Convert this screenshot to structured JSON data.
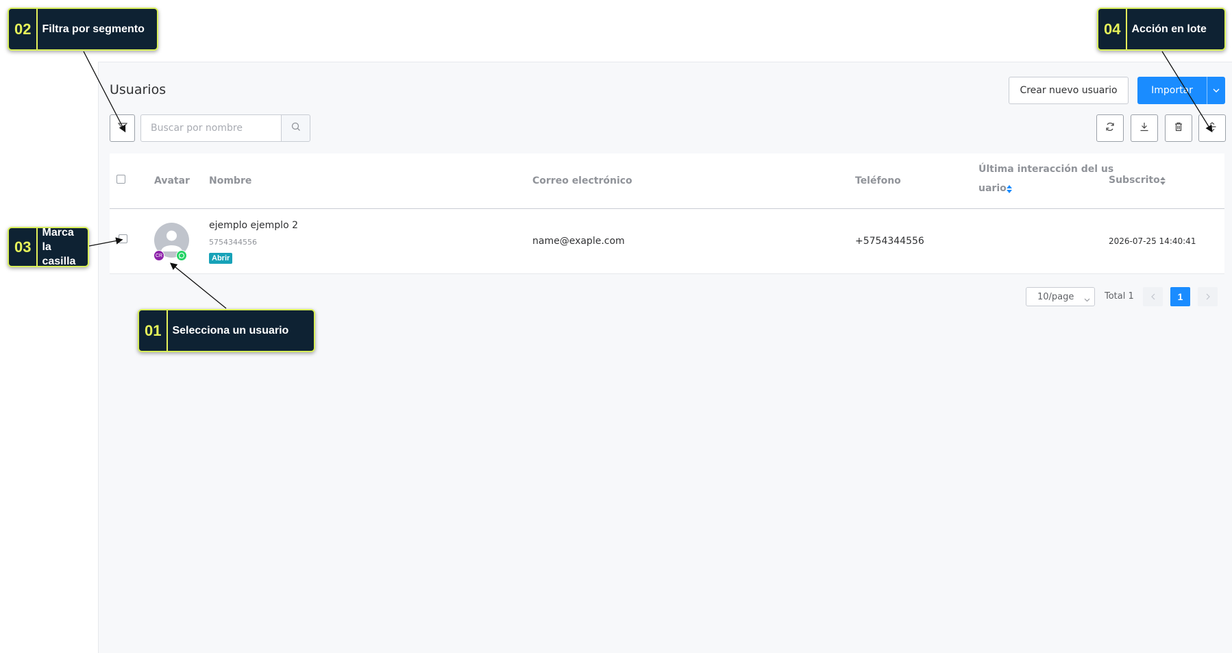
{
  "page": {
    "title": "Usuarios"
  },
  "toolbar": {
    "create_label": "Crear nuevo usuario",
    "import_label": "Importar",
    "search_placeholder": "Buscar por nombre"
  },
  "table": {
    "headers": {
      "avatar": "Avatar",
      "name": "Nombre",
      "email": "Correo electrónico",
      "phone": "Teléfono",
      "last_interaction_1": "Última interacción del us",
      "last_interaction_2": "uario",
      "subscribed": "Subscrito"
    },
    "rows": [
      {
        "name": "ejemplo ejemplo 2",
        "id": "5754344556",
        "status": "Abrir",
        "avatar_badge": "CR",
        "email": "name@exaple.com",
        "phone": "+5754344556",
        "last_interaction": "",
        "subscribed": "2026-07-25 14:40:41"
      }
    ]
  },
  "pagination": {
    "page_size": "10/page",
    "total": "Total 1",
    "current": "1"
  },
  "callouts": {
    "c01": {
      "num": "01",
      "text": "Selecciona un usuario"
    },
    "c02": {
      "num": "02",
      "text": "Filtra por segmento"
    },
    "c03": {
      "num": "03",
      "text_1": "Marca",
      "text_2": "la",
      "text_3": "casilla"
    },
    "c04": {
      "num": "04",
      "text": "Acción en lote"
    }
  },
  "colors": {
    "primary": "#1a8cff",
    "callout_bg": "#0e2233",
    "callout_accent": "#e6f35a",
    "status_tag": "#17a2b8"
  },
  "icons": [
    "filter-icon",
    "search-icon",
    "refresh-icon",
    "download-icon",
    "delete-icon",
    "batch-action-icon",
    "chevron-down-icon",
    "chevron-left-icon",
    "chevron-right-icon",
    "sort-icon",
    "user-avatar-icon",
    "whatsapp-icon"
  ]
}
